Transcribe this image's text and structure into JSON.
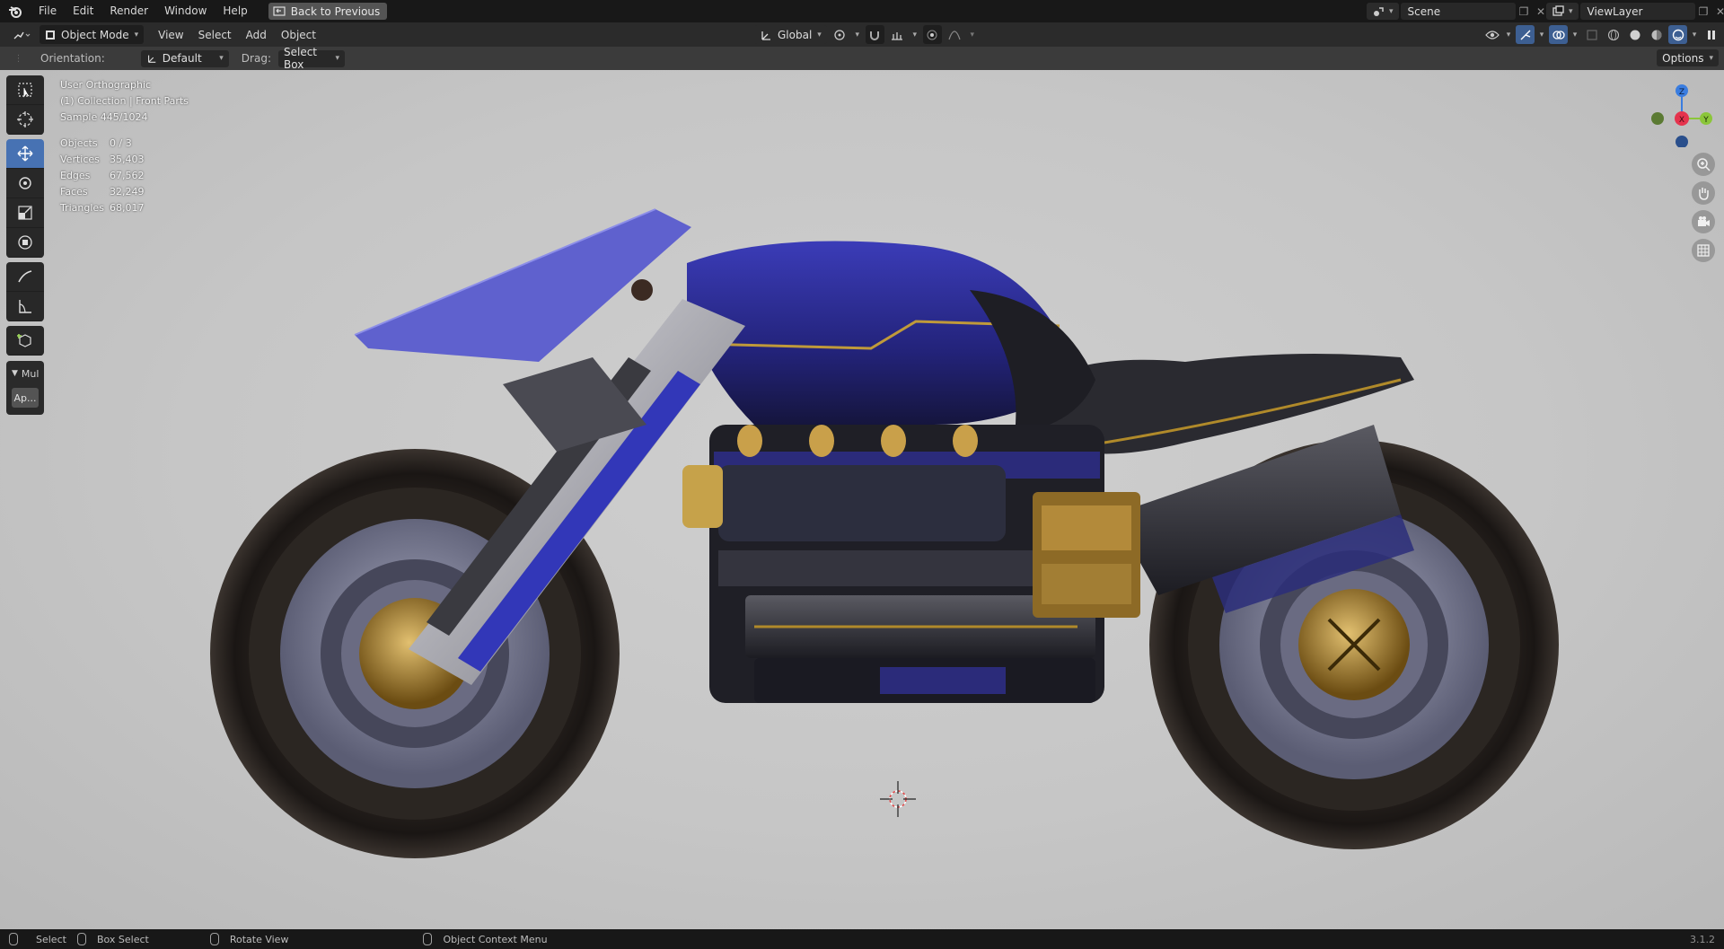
{
  "topbar": {
    "menus": [
      "File",
      "Edit",
      "Render",
      "Window",
      "Help"
    ],
    "back_button": "Back to Previous",
    "scene_name": "Scene",
    "view_layer": "ViewLayer"
  },
  "header": {
    "mode": "Object Mode",
    "menus": [
      "View",
      "Select",
      "Add",
      "Object"
    ],
    "transform_orientation": "Global"
  },
  "tool_options": {
    "orientation_label": "Orientation:",
    "orientation_value": "Default",
    "drag_label": "Drag:",
    "drag_value": "Select Box",
    "options_button": "Options"
  },
  "viewport": {
    "view_name": "User Orthographic",
    "collection_info": "(1) Collection | Front Parts",
    "sample_info": "Sample 445/1024",
    "stats": [
      {
        "label": "Objects",
        "value": "0 / 3"
      },
      {
        "label": "Vertices",
        "value": "35,403"
      },
      {
        "label": "Edges",
        "value": "67,562"
      },
      {
        "label": "Faces",
        "value": "32,249"
      },
      {
        "label": "Triangles",
        "value": "68,017"
      }
    ],
    "gizmo_axes": {
      "z": "Z",
      "x": "X",
      "y": "Y"
    }
  },
  "side_panel": {
    "header_label": "Mul",
    "apply_button": "Ap..."
  },
  "statusbar": {
    "select": "Select",
    "box_select": "Box Select",
    "rotate_view": "Rotate View",
    "context_menu": "Object Context Menu",
    "version": "3.1.2"
  },
  "colors": {
    "accent": "#4772b3",
    "bike_body": "#2a2a8a",
    "gold": "#b8912e",
    "axis_x": "#e5334d",
    "axis_y": "#8bc63a",
    "axis_z": "#3a7de0"
  }
}
